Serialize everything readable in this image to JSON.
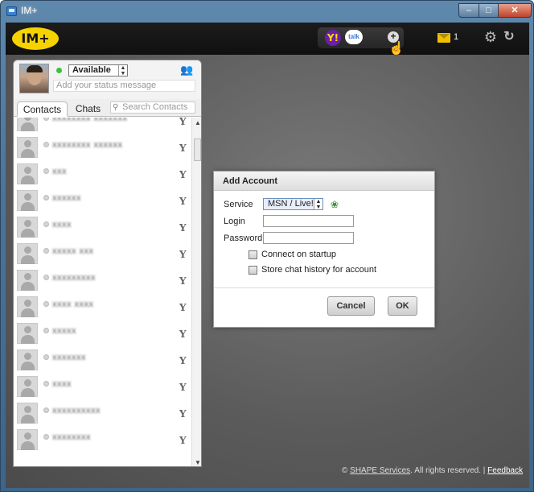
{
  "window": {
    "title": "IM+"
  },
  "window_controls": {
    "minimize": "–",
    "maximize": "□",
    "close": "✕"
  },
  "topbar": {
    "logo": "IM+",
    "services": {
      "yahoo": "Y!",
      "talk": "talk",
      "add": "+"
    },
    "mail_count": "1"
  },
  "profile": {
    "status": "Available",
    "status_placeholder": "Add your status message"
  },
  "tabs": {
    "contacts": "Contacts",
    "chats": "Chats"
  },
  "search": {
    "placeholder": "Search Contacts"
  },
  "contacts": [
    {
      "name": "xxxxxxxx xxxxxxx",
      "service": "Y"
    },
    {
      "name": "xxxxxxxx xxxxxx",
      "service": "Y"
    },
    {
      "name": "xxx",
      "service": "Y"
    },
    {
      "name": "xxxxxx",
      "service": "Y"
    },
    {
      "name": "xxxx",
      "service": "Y"
    },
    {
      "name": "xxxxx xxx",
      "service": "Y"
    },
    {
      "name": "xxxxxxxxx",
      "service": "Y"
    },
    {
      "name": "xxxx xxxx",
      "service": "Y"
    },
    {
      "name": "xxxxx",
      "service": "Y"
    },
    {
      "name": "xxxxxxx",
      "service": "Y"
    },
    {
      "name": "xxxx",
      "service": "Y"
    },
    {
      "name": "xxxxxxxxxx",
      "service": "Y"
    },
    {
      "name": "xxxxxxxx",
      "service": "Y"
    }
  ],
  "dialog": {
    "title": "Add Account",
    "service_label": "Service",
    "service_value": "MSN / Live!",
    "login_label": "Login",
    "password_label": "Password",
    "connect_on_startup": "Connect on startup",
    "store_history": "Store chat history for account",
    "cancel": "Cancel",
    "ok": "OK"
  },
  "footer": {
    "copyright": "©",
    "company": "SHAPE Services",
    "rights": ". All rights reserved. |",
    "feedback": "Feedback"
  }
}
